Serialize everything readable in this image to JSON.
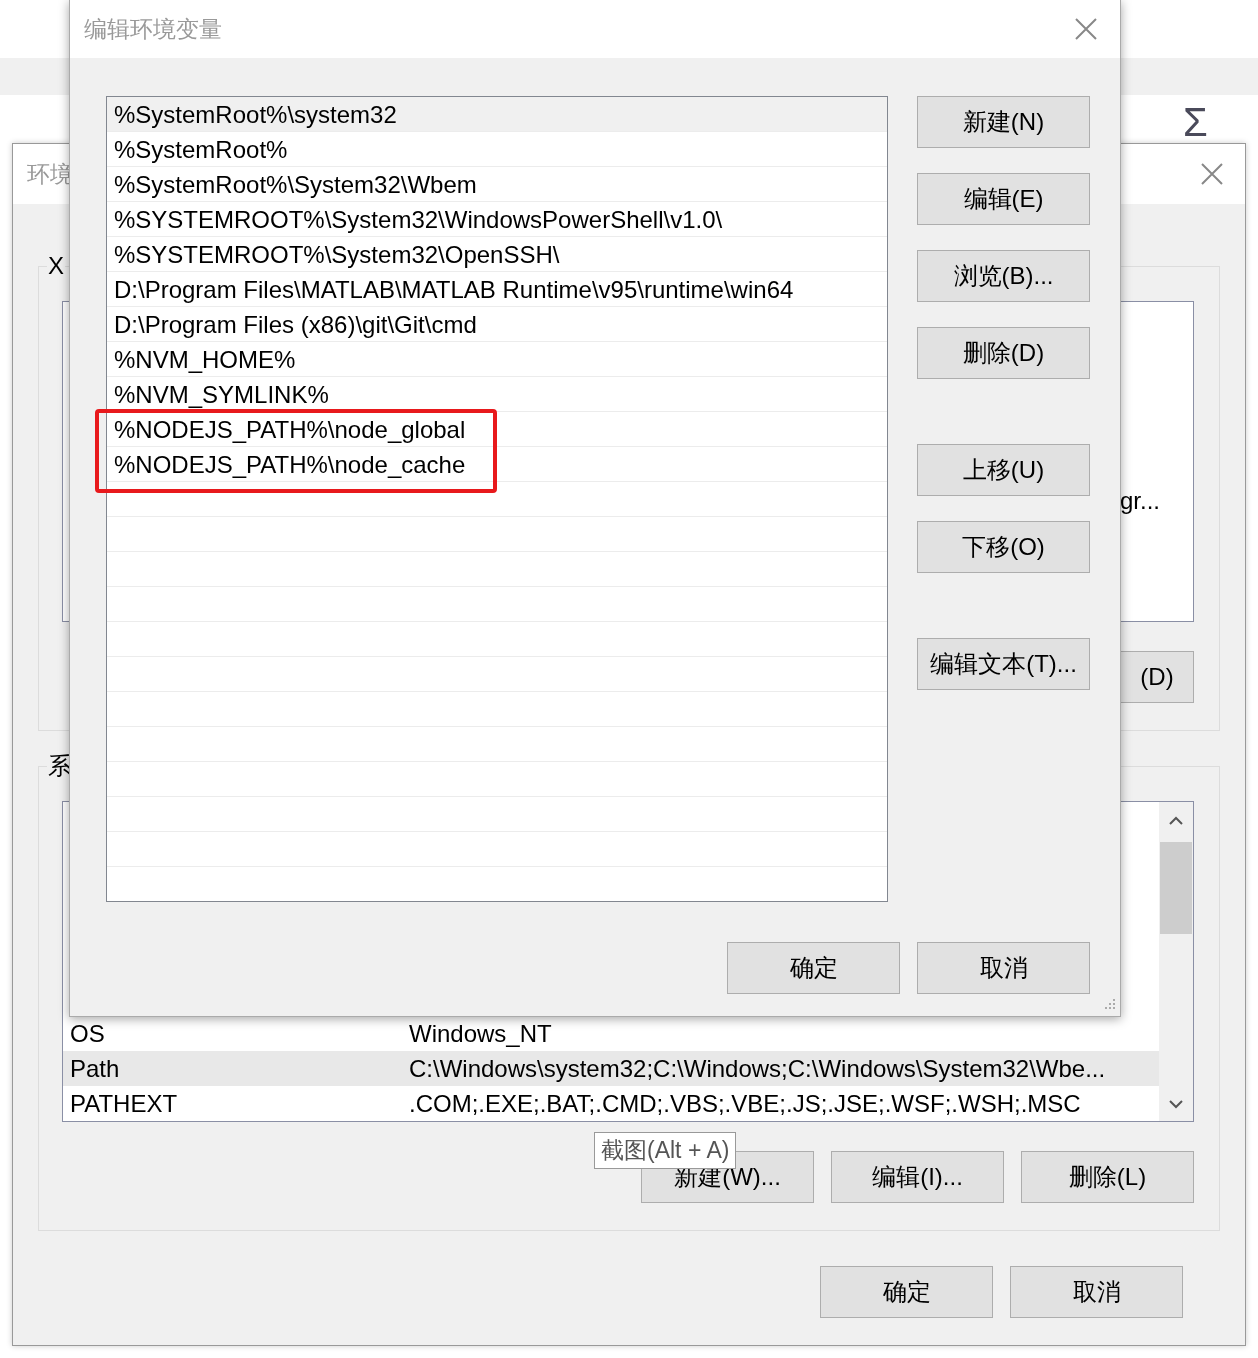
{
  "background_app": {
    "symbol": "Σ"
  },
  "back_dialog": {
    "title": "环境",
    "user_group": {
      "label": "X",
      "list_fragment": "gr...",
      "button_fragment": "(D)"
    },
    "system_group": {
      "label": "系",
      "rows": [
        {
          "name": "OS",
          "value": "Windows_NT",
          "selected": false
        },
        {
          "name": "Path",
          "value": "C:\\Windows\\system32;C:\\Windows;C:\\Windows\\System32\\Wbe...",
          "selected": true
        },
        {
          "name": "PATHEXT",
          "value": ".COM;.EXE;.BAT;.CMD;.VBS;.VBE;.JS;.JSE;.WSF;.WSH;.MSC",
          "selected": false
        }
      ],
      "buttons": [
        "新建(W)...",
        "编辑(I)...",
        "删除(L)"
      ]
    },
    "buttons": [
      "确定",
      "取消"
    ]
  },
  "dialog": {
    "title": "编辑环境变量",
    "paths": [
      {
        "text": "%SystemRoot%\\system32",
        "selected": true,
        "highlighted": false
      },
      {
        "text": "%SystemRoot%",
        "selected": false,
        "highlighted": false
      },
      {
        "text": "%SystemRoot%\\System32\\Wbem",
        "selected": false,
        "highlighted": false
      },
      {
        "text": "%SYSTEMROOT%\\System32\\WindowsPowerShell\\v1.0\\",
        "selected": false,
        "highlighted": false
      },
      {
        "text": "%SYSTEMROOT%\\System32\\OpenSSH\\",
        "selected": false,
        "highlighted": false
      },
      {
        "text": "D:\\Program Files\\MATLAB\\MATLAB Runtime\\v95\\runtime\\win64",
        "selected": false,
        "highlighted": false
      },
      {
        "text": "D:\\Program Files (x86)\\git\\Git\\cmd",
        "selected": false,
        "highlighted": false
      },
      {
        "text": "%NVM_HOME%",
        "selected": false,
        "highlighted": false
      },
      {
        "text": "%NVM_SYMLINK%",
        "selected": false,
        "highlighted": false
      },
      {
        "text": "%NODEJS_PATH%\\node_global",
        "selected": false,
        "highlighted": true
      },
      {
        "text": "%NODEJS_PATH%\\node_cache",
        "selected": false,
        "highlighted": true
      }
    ],
    "buttons": [
      "新建(N)",
      "编辑(E)",
      "浏览(B)...",
      "删除(D)",
      "上移(U)",
      "下移(O)",
      "编辑文本(T)..."
    ],
    "footer_buttons": [
      "确定",
      "取消"
    ]
  },
  "tooltip": {
    "text": "截图(Alt + A)"
  }
}
